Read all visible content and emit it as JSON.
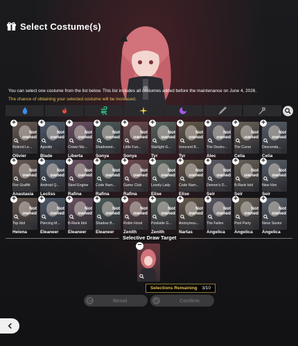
{
  "header": {
    "title": "Select Costume(s)",
    "icon": "gift-icon"
  },
  "description": {
    "line1": "You can select one costume from the list below. This list includes all costumes added before the maintenance on June 4, 2026.",
    "line2": "The chance of obtaining your selected costume will be increased."
  },
  "colors": {
    "accent": "#e8c25a",
    "tab_bg": "#2a2a2d",
    "button_disabled": "#3a3a3d"
  },
  "filter_tabs": [
    {
      "icon": "water-drop-icon",
      "color": "#3d8ff0"
    },
    {
      "icon": "fire-icon",
      "color": "#ef4a3a"
    },
    {
      "icon": "wind-icon",
      "color": "#2fcf8a"
    },
    {
      "icon": "light-icon",
      "color": "#f2d14a"
    },
    {
      "icon": "dark-icon",
      "color": "#a05ae8"
    },
    {
      "icon": "sword-icon",
      "color": "#9a9a9d"
    },
    {
      "icon": "wand-icon",
      "color": "#9a9a9d"
    }
  ],
  "overlay_text": "Not\nowned",
  "costumes": [
    {
      "name": "Retired Le...",
      "char": "Olivier"
    },
    {
      "name": "Apostle",
      "char": "Blade"
    },
    {
      "name": "Crown Me...",
      "char": "Liberta"
    },
    {
      "name": "Shadowed...",
      "char": "Sonya"
    },
    {
      "name": "Little Fun...",
      "char": "Sonya"
    },
    {
      "name": "Starlight G...",
      "char": "Tyr"
    },
    {
      "name": "Innocent B...",
      "char": "Tyr"
    },
    {
      "name": "The Destru...",
      "char": "Alec"
    },
    {
      "name": "The Curse",
      "char": "Celia"
    },
    {
      "name": "Descenda...",
      "char": "Celia"
    },
    {
      "name": "Fire Graffiti",
      "char": "Anastasia"
    },
    {
      "name": "Android Q...",
      "char": "Lecliss"
    },
    {
      "name": "Steel Engine",
      "char": "Rafina"
    },
    {
      "name": "Code Nam...",
      "char": "Rafina"
    },
    {
      "name": "Game Club",
      "char": "Rafina"
    },
    {
      "name": "Lovely Lady",
      "char": "Elise"
    },
    {
      "name": "Code Nam...",
      "char": "Elise"
    },
    {
      "name": "Demon's D...",
      "char": "Seir"
    },
    {
      "name": "B-Rank Idol",
      "char": "Seir"
    },
    {
      "name": "New Hire",
      "char": "Seir"
    },
    {
      "name": "Top Idol",
      "char": "Helena"
    },
    {
      "name": "Piercing M...",
      "char": "Eleaneer"
    },
    {
      "name": "B-Rank Idol",
      "char": "Eleaneer"
    },
    {
      "name": "Shadow B...",
      "char": "Eleaneer"
    },
    {
      "name": "Robin Hood",
      "char": "Zenith"
    },
    {
      "name": "Poolside G...",
      "char": "Zenith"
    },
    {
      "name": "Anonymou...",
      "char": "Nartas"
    },
    {
      "name": "The Fallen",
      "char": "Angelica"
    },
    {
      "name": "Pool Party",
      "char": "Angelica"
    },
    {
      "name": "Neon Savior",
      "char": "Angelica"
    }
  ],
  "selective": {
    "label": "Selective Draw Target",
    "remaining_label": "Selections Remaining",
    "remaining_count": "3/10"
  },
  "buttons": {
    "reset": "Reset",
    "confirm": "Confirm"
  }
}
